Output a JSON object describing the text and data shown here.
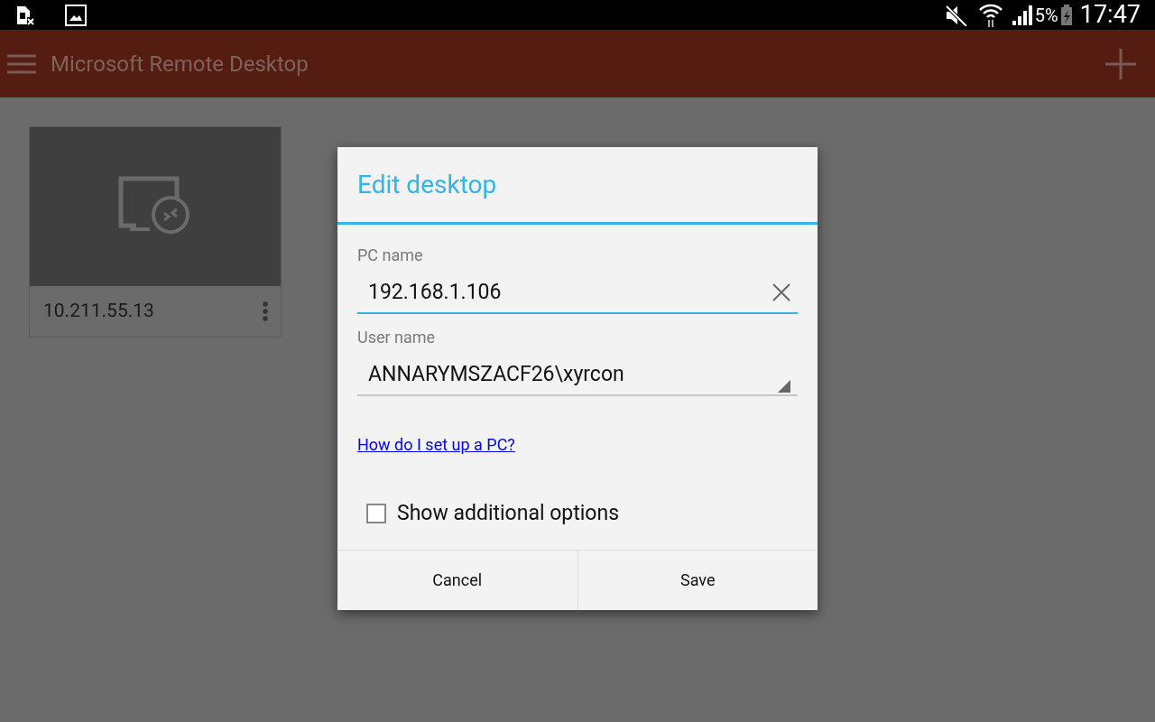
{
  "status_bar": {
    "battery": "5%",
    "time": "17:47"
  },
  "app_bar": {
    "title": "Microsoft Remote Desktop"
  },
  "desktops": [
    {
      "name": "10.211.55.13"
    }
  ],
  "dialog": {
    "title": "Edit desktop",
    "fields": [
      {
        "kind": "text",
        "label": "PC name",
        "value": "192.168.1.106",
        "focused": true
      },
      {
        "kind": "dropdown",
        "label": "User name",
        "value": "ANNARYMSZACF26\\xyrcon",
        "focused": false
      }
    ],
    "help_link": "How do I set up a PC?",
    "checkbox": {
      "label": "Show additional options",
      "checked": false
    },
    "buttons": [
      "Cancel",
      "Save"
    ]
  }
}
